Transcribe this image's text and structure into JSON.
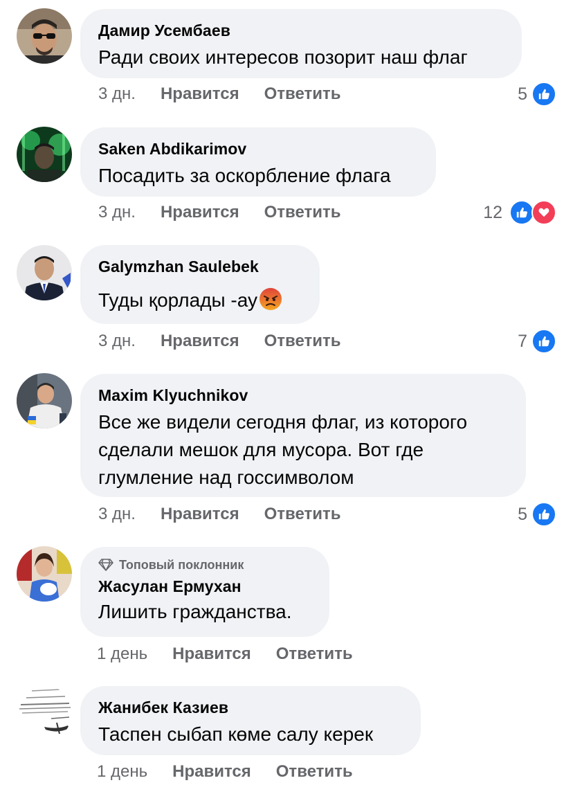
{
  "comments": [
    {
      "author": "Дамир Усембаев",
      "text": "Ради своих интересов позорит наш флаг",
      "time": "3 дн.",
      "like": "Нравится",
      "reply": "Ответить",
      "reaction_count": "5"
    },
    {
      "author": "Saken Abdikarimov",
      "text": "Посадить за оскорбление флага",
      "time": "3 дн.",
      "like": "Нравится",
      "reply": "Ответить",
      "reaction_count": "12"
    },
    {
      "author": "Galymzhan Saulebek",
      "text": "Туды қорлады -ау",
      "time": "3 дн.",
      "like": "Нравится",
      "reply": "Ответить",
      "reaction_count": "7"
    },
    {
      "author": "Maxim Klyuchnikov",
      "text": "Все же видели сегодня флаг, из которого сделали мешок для мусора. Вот где глумление над госсимволом",
      "time": "3 дн.",
      "like": "Нравится",
      "reply": "Ответить",
      "reaction_count": "5"
    },
    {
      "badge": "Топовый поклонник",
      "author": "Жасулан Ермухан",
      "text": "Лишить гражданства.",
      "time": "1 день",
      "like": "Нравится",
      "reply": "Ответить"
    },
    {
      "author": "Жанибек Казиев",
      "text": "Таспен сыбап көме салу керек",
      "time": "1 день",
      "like": "Нравится",
      "reply": "Ответить"
    }
  ],
  "colors": {
    "bubble": "#f0f2f5",
    "secondary_text": "#65676b",
    "like_blue": "#1877f2",
    "love_red": "#f33e58"
  }
}
